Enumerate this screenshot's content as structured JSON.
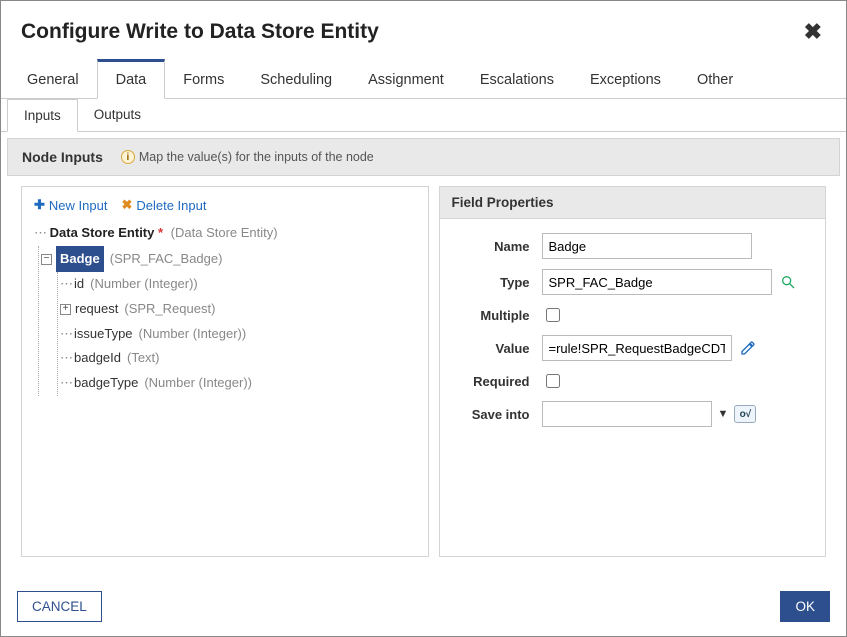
{
  "dialog": {
    "title": "Configure Write to Data Store Entity"
  },
  "tabs_primary": {
    "items": [
      "General",
      "Data",
      "Forms",
      "Scheduling",
      "Assignment",
      "Escalations",
      "Exceptions",
      "Other"
    ],
    "active_index": 1
  },
  "tabs_secondary": {
    "items": [
      "Inputs",
      "Outputs"
    ],
    "active_index": 0
  },
  "section": {
    "title": "Node Inputs",
    "hint": "Map the value(s) for the inputs of the node"
  },
  "toolbar": {
    "new_input": "New Input",
    "delete_input": "Delete Input"
  },
  "tree": {
    "root": {
      "label": "Data Store Entity",
      "type": "(Data Store Entity)",
      "required": true
    },
    "selected": {
      "label": "Badge",
      "type": "(SPR_FAC_Badge)"
    },
    "children": [
      {
        "label": "id",
        "type": "(Number (Integer))",
        "expandable": false
      },
      {
        "label": "request",
        "type": "(SPR_Request)",
        "expandable": true
      },
      {
        "label": "issueType",
        "type": "(Number (Integer))",
        "expandable": false
      },
      {
        "label": "badgeId",
        "type": "(Text)",
        "expandable": false
      },
      {
        "label": "badgeType",
        "type": "(Number (Integer))",
        "expandable": false
      }
    ]
  },
  "field_properties": {
    "header": "Field Properties",
    "labels": {
      "name": "Name",
      "type": "Type",
      "multiple": "Multiple",
      "value": "Value",
      "required": "Required",
      "save_into": "Save into"
    },
    "values": {
      "name": "Badge",
      "type": "SPR_FAC_Badge",
      "multiple": false,
      "value": "=rule!SPR_RequestBadgeCDT(p",
      "required": false,
      "save_into": ""
    }
  },
  "footer": {
    "cancel": "CANCEL",
    "ok": "OK"
  }
}
